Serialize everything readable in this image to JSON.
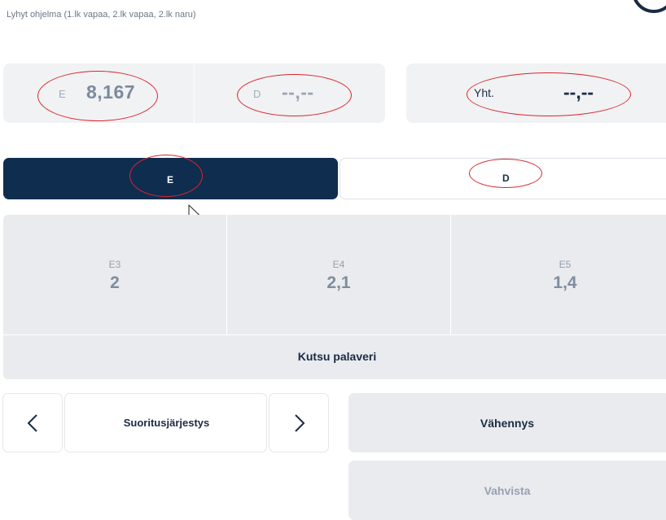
{
  "header": {
    "subtitle": "Lyhyt ohjelma (1.lk vapaa, 2.lk vapaa, 2.lk naru)"
  },
  "scores": {
    "e_label": "E",
    "e_value": "8,167",
    "d_label": "D",
    "d_value": "--,--",
    "total_label": "Yht.",
    "total_value": "--,--"
  },
  "tabs": [
    {
      "label": "E",
      "active": true
    },
    {
      "label": "D",
      "active": false
    }
  ],
  "elements": [
    {
      "label": "E3",
      "value": "2"
    },
    {
      "label": "E4",
      "value": "2,1"
    },
    {
      "label": "E5",
      "value": "1,4"
    }
  ],
  "actions": {
    "call_meeting": "Kutsu palaveri",
    "order_label": "Suoritusjärjestys",
    "prev_icon": "chevron-left-icon",
    "next_icon": "chevron-right-icon",
    "deduction": "Vähennys",
    "confirm": "Vahvista"
  },
  "colors": {
    "active_tab": "#0f2d4f",
    "annotation": "#d8262d"
  }
}
